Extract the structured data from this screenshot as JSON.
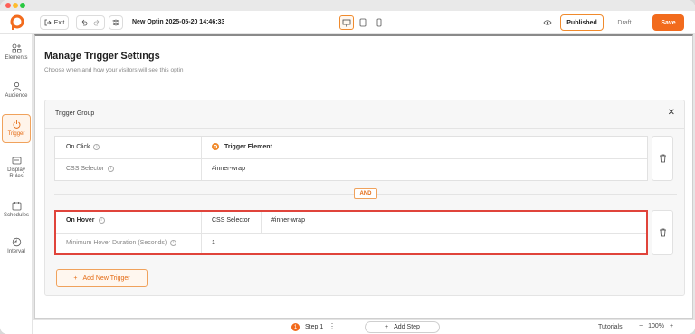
{
  "toolbar": {
    "exit_label": "Exit",
    "doc_title": "New Optin 2025-05-20 14:46:33",
    "published_label": "Published",
    "draft_label": "Draft",
    "save_label": "Save"
  },
  "sidebar": {
    "items": [
      {
        "label": "Elements",
        "icon": "elements-icon"
      },
      {
        "label": "Audience",
        "icon": "audience-icon"
      },
      {
        "label": "Trigger",
        "icon": "power-icon",
        "active": true
      },
      {
        "label": "Display Rules",
        "icon": "display-rules-icon"
      },
      {
        "label": "Schedules",
        "icon": "calendar-icon"
      },
      {
        "label": "Interval",
        "icon": "interval-icon"
      }
    ]
  },
  "panel": {
    "title": "Manage Trigger Settings",
    "subtitle": "Choose when and how your visitors will see this optin"
  },
  "group": {
    "title": "Trigger Group",
    "triggers": [
      {
        "name": "On Click",
        "option": "Trigger Element",
        "selector_label": "CSS Selector",
        "selector_value": "#inner-wrap"
      },
      {
        "name": "On Hover",
        "selector_label": "CSS Selector",
        "selector_value": "#inner-wrap",
        "duration_label": "Minimum Hover Duration (Seconds)",
        "duration_value": "1"
      }
    ],
    "and_label": "AND",
    "add_trigger_label": "Add New Trigger"
  },
  "bottom": {
    "step_number": "1",
    "step_label": "Step 1",
    "add_step_label": "Add Step",
    "tutorials_label": "Tutorials",
    "zoom_value": "100%"
  },
  "colors": {
    "accent": "#f26b1d",
    "highlight": "#e0443b"
  }
}
